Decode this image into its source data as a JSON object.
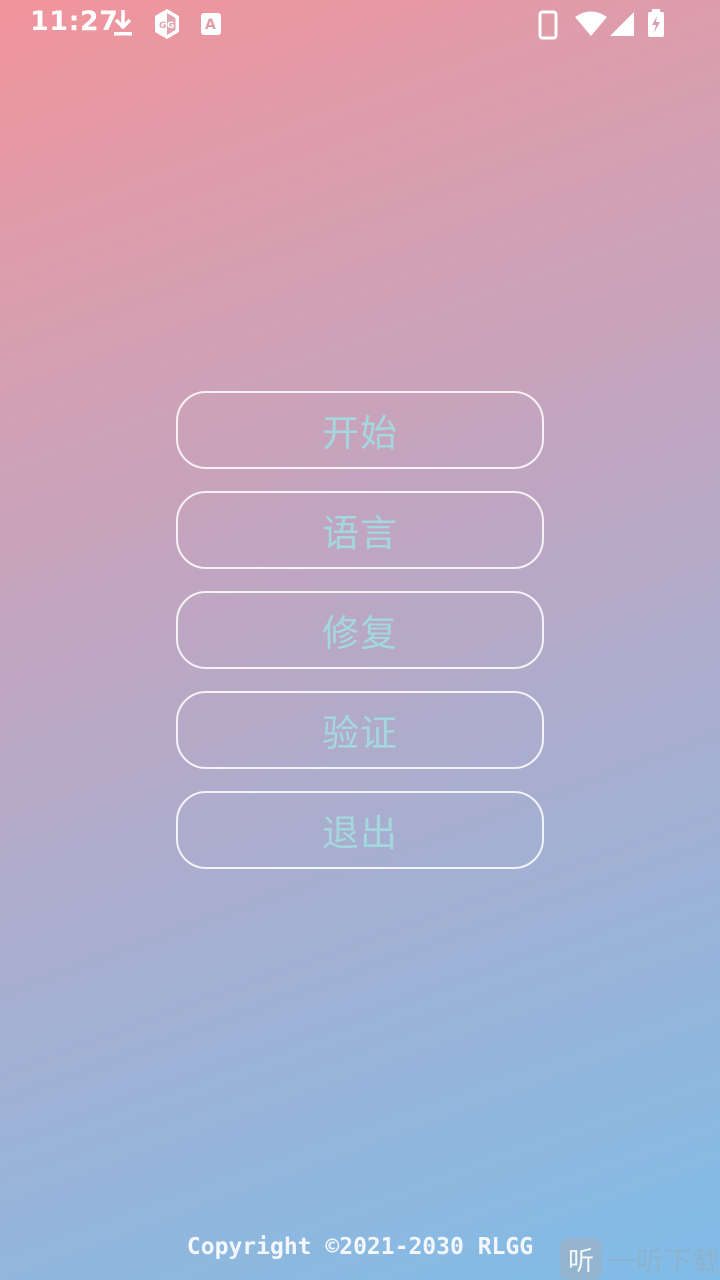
{
  "status_bar": {
    "time": "11:27",
    "icons": [
      "download-icon",
      "gg-app-icon",
      "a-badge-icon",
      "phone-vibrate-icon",
      "wifi-icon",
      "signal-icon",
      "battery-charging-icon"
    ]
  },
  "menu": {
    "buttons": [
      {
        "label": "开始"
      },
      {
        "label": "语言"
      },
      {
        "label": "修复"
      },
      {
        "label": "验证"
      },
      {
        "label": "退出"
      }
    ]
  },
  "footer": {
    "copyright": "Copyright ©2021-2030 RLGG"
  },
  "watermark": {
    "icon_glyph": "听",
    "text": "一听下载"
  },
  "colors": {
    "button_text": "#a3d8de",
    "button_border": "#ffffff",
    "gradient_start": "#f2949b",
    "gradient_end": "#7fbde8"
  }
}
